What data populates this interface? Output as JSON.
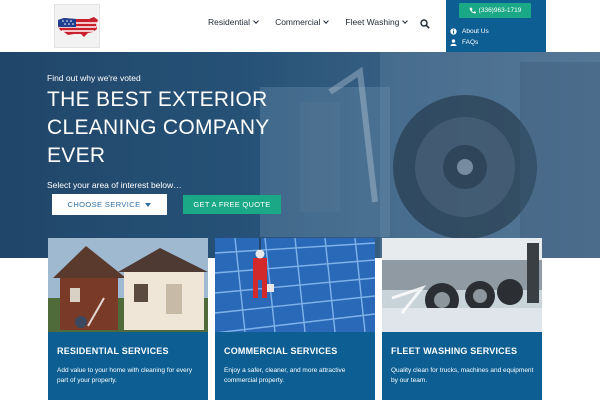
{
  "header": {
    "logo_icon": "usa-map-flag-logo",
    "nav": [
      {
        "label": "Residential"
      },
      {
        "label": "Commercial"
      },
      {
        "label": "Fleet Washing"
      }
    ],
    "search_icon": "search-icon"
  },
  "right_panel": {
    "phone": "(336)963-1719",
    "links": [
      {
        "label": "About Us",
        "icon": "info-icon"
      },
      {
        "label": "FAQs",
        "icon": "user-icon"
      }
    ]
  },
  "hero": {
    "subtitle": "Find out why we're voted",
    "title": "THE BEST EXTERIOR CLEANING COMPANY EVER",
    "select_prompt": "Select your area of interest below…",
    "choose_button": "CHOOSE SERVICE",
    "quote_button": "GET A FREE QUOTE"
  },
  "cards": [
    {
      "title": "RESIDENTIAL SERVICES",
      "text": "Add value to your home with cleaning for every part of your property."
    },
    {
      "title": "COMMERCIAL SERVICES",
      "text": "Enjoy a safer, cleaner, and more attractive commercial property."
    },
    {
      "title": "FLEET WASHING SERVICES",
      "text": "Quality clean for trucks, machines and equipment by our team."
    }
  ],
  "colors": {
    "brand_blue": "#0c5e93",
    "accent_green": "#1aa886",
    "hero_blue": "#2c5a80"
  }
}
